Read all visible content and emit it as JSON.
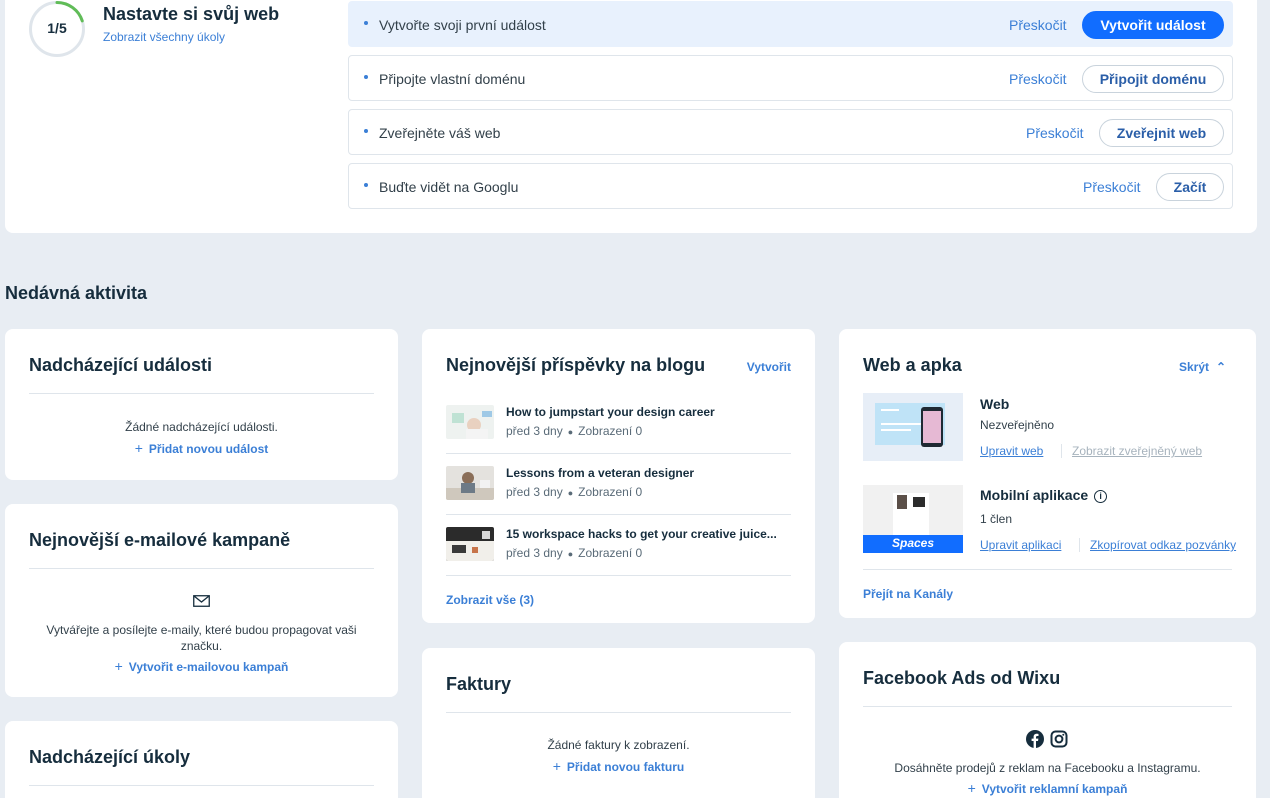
{
  "setup": {
    "progress": "1/5",
    "progress_fraction": 0.2,
    "title": "Nastavte si svůj web",
    "show_all_tasks": "Zobrazit všechny úkoly",
    "tasks": [
      {
        "label": "Vytvořte svoji první událost",
        "skip": "Přeskočit",
        "button": "Vytvořit událost",
        "active": true
      },
      {
        "label": "Připojte vlastní doménu",
        "skip": "Přeskočit",
        "button": "Připojit doménu",
        "active": false
      },
      {
        "label": "Zveřejněte váš web",
        "skip": "Přeskočit",
        "button": "Zveřejnit web",
        "active": false
      },
      {
        "label": "Buďte vidět na Googlu",
        "skip": "Přeskočit",
        "button": "Začít",
        "active": false
      }
    ]
  },
  "recent": {
    "title": "Nedávná aktivita"
  },
  "events_card": {
    "title": "Nadcházející události",
    "empty": "Žádné nadcházející události.",
    "add": "Přidat novou událost"
  },
  "email_card": {
    "title": "Nejnovější e-mailové kampaně",
    "icon": "envelope-icon",
    "text_line1": "Vytvářejte a posílejte e-maily, které budou propagovat vaši",
    "text_line2": "značku.",
    "add": "Vytvořit e-mailovou kampaň"
  },
  "tasks_card": {
    "title": "Nadcházející úkoly"
  },
  "blog_card": {
    "title": "Nejnovější příspěvky na blogu",
    "create": "Vytvořit",
    "posts": [
      {
        "title": "How to jumpstart your design career",
        "date": "před 3 dny",
        "views": "Zobrazení 0"
      },
      {
        "title": "Lessons from a veteran designer",
        "date": "před 3 dny",
        "views": "Zobrazení 0"
      },
      {
        "title": "15 workspace hacks to get your creative juice...",
        "date": "před 3 dny",
        "views": "Zobrazení 0"
      }
    ],
    "show_all": "Zobrazit vše (3)"
  },
  "invoices_card": {
    "title": "Faktury",
    "empty": "Žádné faktury k zobrazení.",
    "add": "Přidat novou fakturu"
  },
  "webapp_card": {
    "title": "Web a apka",
    "hide": "Skrýt",
    "web": {
      "title": "Web",
      "status": "Nezveřejněno",
      "edit": "Upravit web",
      "view": "Zobrazit zveřejněný web"
    },
    "app": {
      "title": "Mobilní aplikace",
      "members": "1 člen",
      "edit": "Upravit aplikaci",
      "copy": "Zkopírovat odkaz pozvánky",
      "badge": "Spaces"
    },
    "channels": "Přejít na Kanály"
  },
  "facebook_card": {
    "title": "Facebook Ads od Wixu",
    "text": "Dosáhněte prodejů z reklam na Facebooku a Instagramu.",
    "add": "Vytvořit reklamní kampaň"
  },
  "colors": {
    "accent": "#116dff",
    "link": "#3b7fd6",
    "background": "#e8edf3",
    "progress": "#60bc57"
  }
}
